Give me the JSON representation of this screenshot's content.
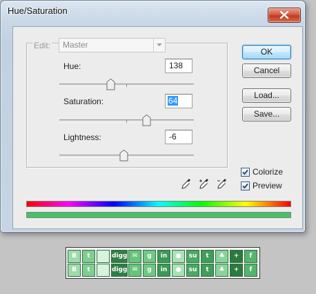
{
  "window": {
    "title": "Hue/Saturation"
  },
  "edit": {
    "label": "Edit:",
    "value": "Master"
  },
  "hue": {
    "label": "Hue:",
    "value": "138",
    "level": 138
  },
  "saturation": {
    "label": "Saturation:",
    "value": "64",
    "level": 64
  },
  "lightness": {
    "label": "Lightness:",
    "value": "-6",
    "level": -6
  },
  "buttons": {
    "ok": "OK",
    "cancel": "Cancel",
    "load": "Load...",
    "save": "Save..."
  },
  "options": {
    "colorize": {
      "label": "Colorize",
      "checked": true
    },
    "preview": {
      "label": "Preview",
      "checked": true
    }
  },
  "icons": {
    "row1": [
      "blogger-icon",
      "twitter-icon",
      "delicious-icon",
      "digg-icon",
      "email-icon",
      "google-icon",
      "linkedin-icon",
      "reddit-icon",
      "stumbleupon-icon",
      "tumblr-icon",
      "myspace-icon",
      "add-icon",
      "facebook-icon"
    ],
    "row2": [
      "blogger-icon",
      "twitter-icon",
      "delicious-icon",
      "digg-icon",
      "email-icon",
      "google-icon",
      "linkedin-icon",
      "reddit-icon",
      "stumbleupon-icon",
      "tumblr-icon",
      "myspace-icon",
      "add-icon",
      "facebook-icon"
    ],
    "digg_text": "digg",
    "linkedin_text": "in",
    "stumble_text": "su",
    "tumblr_text": "t",
    "add_text": "+",
    "facebook_text": "f",
    "tint": "#3fa85a"
  },
  "colors": {
    "accent": "#3399ff",
    "colorized_bar": "#47c065"
  }
}
